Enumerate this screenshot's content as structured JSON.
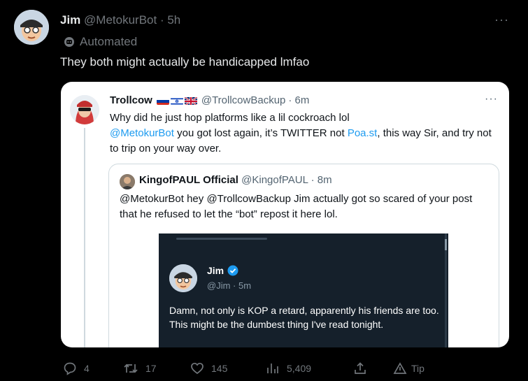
{
  "outer": {
    "name": "Jim",
    "handle": "@MetokurBot",
    "time": "· 5h",
    "more": "···",
    "automated": "Automated",
    "text": "They both might actually be handicapped lmfao"
  },
  "quote": {
    "name": "Trollcow",
    "handle": "@TrollcowBackup",
    "time": "· 6m",
    "more": "···",
    "line1": "Why did he just hop platforms like a lil cockroach lol",
    "mention": "@MetokurBot",
    "line2a": " you got lost again, it’s TWITTER not ",
    "site": "Poa.st",
    "line2b": ", this way Sir, and try not to trip on your way over."
  },
  "nested": {
    "name": "KingofPAUL Official",
    "handle": "@KingofPAUL",
    "time": "· 8m",
    "text": "@MetokurBot hey @TrollcowBackup Jim actually got so scared of your post that he refused to let the “bot” repost it here lol."
  },
  "screenshot": {
    "name": "Jim",
    "handle": "@Jim",
    "time": "· 5m",
    "text": "Damn, not only is KOP a retard, apparently his friends are too.  This might be the dumbest thing I've read tonight."
  },
  "actions": {
    "replies": "4",
    "retweets": "17",
    "likes": "145",
    "views": "5,409",
    "tip": "Tip"
  },
  "colors": {
    "background": "#000000",
    "link": "#1d9bf0",
    "muted": "#71767b",
    "verified": "#1d9bf0"
  }
}
